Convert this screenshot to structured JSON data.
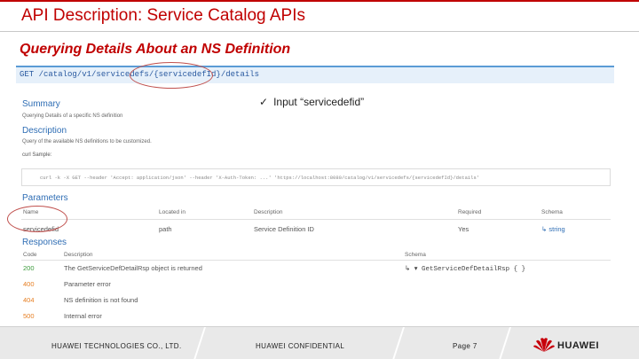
{
  "header": {
    "title": "API Description: Service Catalog APIs"
  },
  "subtitle": "Querying Details About an NS Definition",
  "endpoint": {
    "method_path": "GET /catalog/v1/servicedefs/{servicedefId}/details"
  },
  "summary": {
    "heading": "Summary",
    "text": "Querying Details of a specific NS definition"
  },
  "description": {
    "heading": "Description",
    "text": "Query of the available NS definitions to be customized."
  },
  "curl": {
    "label": "curl Sample:",
    "command": "curl -k -X GET --header 'Accept: application/json' --header 'X-Auth-Token: ...' 'https://localhost:8080/catalog/v1/servicedefs/{servicedefId}/details'"
  },
  "parameters": {
    "heading": "Parameters",
    "columns": [
      "Name",
      "Located in",
      "Description",
      "Required",
      "Schema"
    ],
    "rows": [
      {
        "name": "servicedefid",
        "located": "path",
        "description": "Service Definition ID",
        "required": "Yes",
        "schema": "↳ string"
      }
    ]
  },
  "responses": {
    "heading": "Responses",
    "columns": [
      "Code",
      "Description",
      "Schema"
    ],
    "rows": [
      {
        "code": "200",
        "description": "The GetServiceDefDetailRsp object is returned",
        "schema": "↳ ▾ GetServiceDefDetailRsp { }"
      },
      {
        "code": "400",
        "description": "Parameter error",
        "schema": ""
      },
      {
        "code": "404",
        "description": "NS definition is not found",
        "schema": ""
      },
      {
        "code": "500",
        "description": "Internal error",
        "schema": ""
      }
    ]
  },
  "annotation": {
    "check": "✓",
    "text": "Input “servicedefid”"
  },
  "footer": {
    "company": "HUAWEI TECHNOLOGIES CO., LTD.",
    "confidential": "HUAWEI CONFIDENTIAL",
    "page": "Page 7",
    "logo_text": "HUAWEI"
  },
  "colors": {
    "accent": "#c00000",
    "link": "#2e6db4",
    "ok": "#3c9b3c",
    "error": "#e67e22",
    "circle": "#c0504d"
  }
}
